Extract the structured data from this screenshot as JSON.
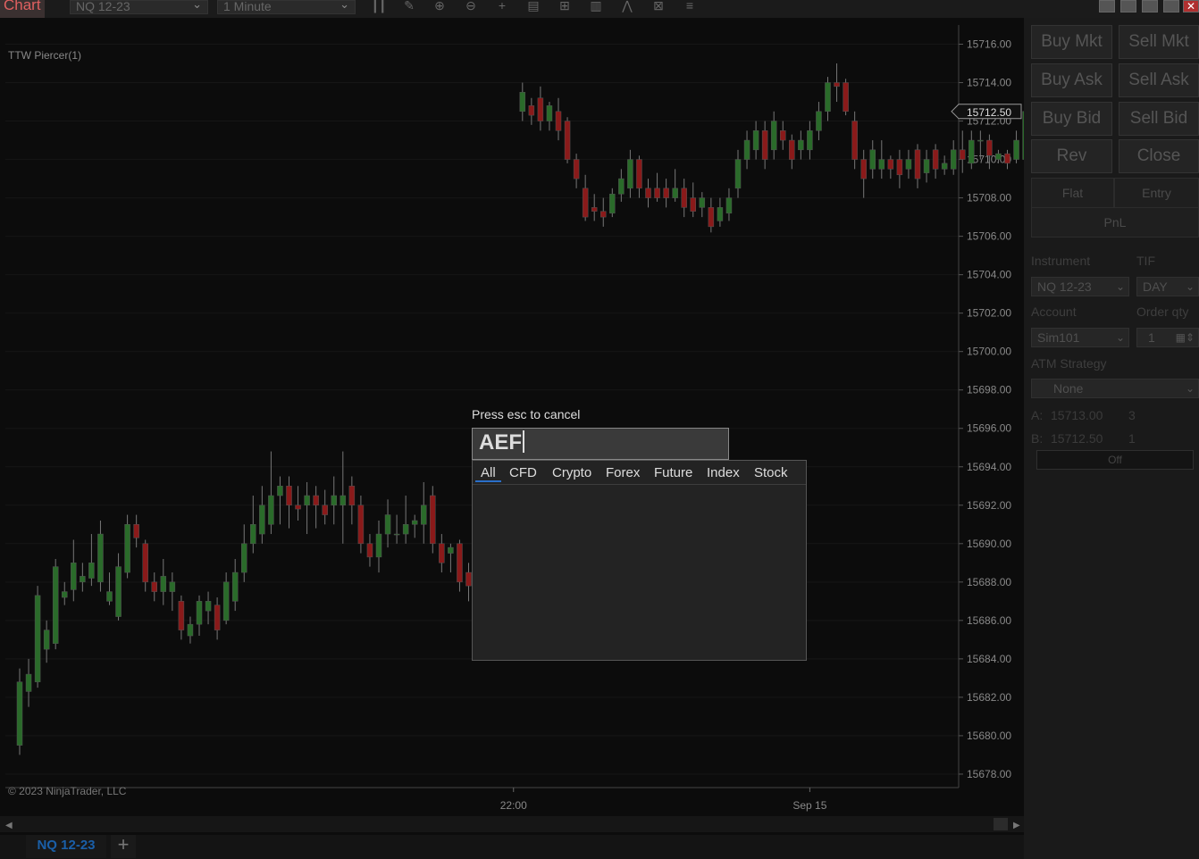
{
  "window": {
    "title": "Chart"
  },
  "toolbar": {
    "instrument": "NQ 12-23",
    "interval": "1 Minute",
    "icons": [
      "bars-type-icon",
      "pencil-draw-icon",
      "zoom-in-icon",
      "zoom-out-icon",
      "crosshair-icon",
      "data-box-icon",
      "strategy-icon",
      "indicators-icon",
      "drawing-tools-icon",
      "templates-icon",
      "properties-list-icon"
    ]
  },
  "chart": {
    "indicator_label": "TTW Piercer(1)",
    "copyright": "© 2023 NinjaTrader, LLC",
    "price_axis": [
      "15716.00",
      "15714.00",
      "15712.00",
      "15710.00",
      "15708.00",
      "15706.00",
      "15704.00",
      "15702.00",
      "15700.00",
      "15698.00",
      "15696.00",
      "15694.00",
      "15692.00",
      "15690.00",
      "15688.00",
      "15686.00",
      "15684.00",
      "15682.00",
      "15680.00",
      "15678.00"
    ],
    "last_price": "15712.50",
    "time_axis": [
      {
        "label": "22:00",
        "bar": 55
      },
      {
        "label": "Sep 15",
        "bar": 88
      }
    ],
    "up_color": "#2a6b2a",
    "down_color": "#8a1a1a",
    "candles": [
      [
        15679.5,
        15682.8,
        15679.0,
        15683.5
      ],
      [
        15682.3,
        15683.2,
        15681.5,
        15684.0
      ],
      [
        15682.8,
        15687.3,
        15682.5,
        15687.8
      ],
      [
        15684.5,
        15685.5,
        15683.8,
        15686.0
      ],
      [
        15684.8,
        15688.8,
        15684.5,
        15689.2
      ],
      [
        15687.2,
        15687.5,
        15686.8,
        15688.0
      ],
      [
        15687.6,
        15689.0,
        15687.0,
        15690.2
      ],
      [
        15688.0,
        15688.3,
        15687.5,
        15689.0
      ],
      [
        15688.2,
        15689.0,
        15687.8,
        15690.5
      ],
      [
        15688.0,
        15690.5,
        15687.5,
        15691.2
      ],
      [
        15687.0,
        15687.5,
        15686.8,
        15688.5
      ],
      [
        15686.2,
        15688.8,
        15686.0,
        15689.5
      ],
      [
        15688.5,
        15691.0,
        15688.2,
        15691.5
      ],
      [
        15691.0,
        15690.3,
        15689.8,
        15691.5
      ],
      [
        15690.0,
        15688.0,
        15687.5,
        15690.2
      ],
      [
        15688.0,
        15687.5,
        15687.0,
        15688.5
      ],
      [
        15687.5,
        15688.3,
        15686.8,
        15689.2
      ],
      [
        15687.5,
        15688.0,
        15686.5,
        15688.5
      ],
      [
        15687.0,
        15685.5,
        15685.0,
        15687.3
      ],
      [
        15685.2,
        15685.8,
        15684.8,
        15686.2
      ],
      [
        15685.8,
        15687.0,
        15685.2,
        15687.3
      ],
      [
        15686.5,
        15687.0,
        15685.8,
        15687.5
      ],
      [
        15686.8,
        15685.5,
        15685.0,
        15687.2
      ],
      [
        15686.0,
        15688.0,
        15685.8,
        15688.5
      ],
      [
        15687.0,
        15688.5,
        15686.5,
        15689.2
      ],
      [
        15688.5,
        15690.0,
        15688.0,
        15691.0
      ],
      [
        15690.0,
        15691.0,
        15689.5,
        15692.5
      ],
      [
        15690.5,
        15692.0,
        15690.0,
        15693.0
      ],
      [
        15691.0,
        15692.5,
        15690.5,
        15694.8
      ],
      [
        15692.5,
        15693.0,
        15691.0,
        15693.5
      ],
      [
        15693.0,
        15692.0,
        15690.8,
        15693.5
      ],
      [
        15692.0,
        15691.8,
        15691.2,
        15693.0
      ],
      [
        15692.0,
        15692.5,
        15690.5,
        15693.2
      ],
      [
        15692.5,
        15692.0,
        15690.8,
        15693.0
      ],
      [
        15692.0,
        15691.5,
        15691.0,
        15692.8
      ],
      [
        15692.0,
        15692.5,
        15691.0,
        15693.5
      ],
      [
        15692.0,
        15692.5,
        15690.0,
        15694.8
      ],
      [
        15693.0,
        15692.0,
        15691.0,
        15693.5
      ],
      [
        15692.0,
        15690.0,
        15689.5,
        15692.5
      ],
      [
        15690.0,
        15689.3,
        15688.8,
        15690.5
      ],
      [
        15689.3,
        15690.5,
        15688.5,
        15691.2
      ],
      [
        15690.5,
        15691.5,
        15689.8,
        15692.3
      ],
      [
        15690.5,
        15690.5,
        15690.0,
        15691.5
      ],
      [
        15690.5,
        15691.0,
        15690.0,
        15692.5
      ],
      [
        15691.0,
        15691.2,
        15690.3,
        15691.5
      ],
      [
        15691.0,
        15692.0,
        15690.0,
        15693.2
      ],
      [
        15692.5,
        15690.0,
        15689.5,
        15693.0
      ],
      [
        15690.0,
        15689.0,
        15688.5,
        15690.5
      ],
      [
        15689.5,
        15689.8,
        15688.5,
        15690.0
      ],
      [
        15690.0,
        15688.0,
        15687.5,
        15690.2
      ],
      [
        15688.5,
        15687.8,
        15687.0,
        15689.0
      ],
      [
        15688.0,
        15687.5,
        15686.8,
        15688.8
      ],
      [
        15687.8,
        15687.0,
        15686.8,
        15688.5
      ],
      [
        15687.5,
        15688.2,
        15687.0,
        15688.8
      ],
      [
        15688.0,
        15688.0,
        15687.5,
        15688.3
      ],
      [
        15688.2,
        15688.0,
        15687.8,
        15688.5
      ],
      [
        15712.5,
        15713.5,
        15712.0,
        15714.0
      ],
      [
        15712.8,
        15712.3,
        15711.8,
        15713.2
      ],
      [
        15713.2,
        15712.0,
        15711.5,
        15713.8
      ],
      [
        15712.0,
        15712.8,
        15711.5,
        15713.0
      ],
      [
        15712.5,
        15711.5,
        15711.0,
        15713.2
      ],
      [
        15712.0,
        15710.0,
        15709.8,
        15712.2
      ],
      [
        15710.0,
        15709.0,
        15708.5,
        15710.3
      ],
      [
        15708.5,
        15707.0,
        15706.8,
        15709.2
      ],
      [
        15707.5,
        15707.3,
        15706.8,
        15708.2
      ],
      [
        15707.3,
        15707.0,
        15706.5,
        15708.0
      ],
      [
        15707.2,
        15708.2,
        15707.0,
        15708.5
      ],
      [
        15708.2,
        15709.0,
        15707.8,
        15709.5
      ],
      [
        15708.5,
        15710.0,
        15708.0,
        15710.5
      ],
      [
        15710.0,
        15708.5,
        15708.0,
        15710.2
      ],
      [
        15708.5,
        15708.0,
        15707.5,
        15709.0
      ],
      [
        15708.5,
        15708.0,
        15707.8,
        15709.3
      ],
      [
        15708.5,
        15708.0,
        15707.5,
        15709.0
      ],
      [
        15708.0,
        15708.5,
        15707.8,
        15709.5
      ],
      [
        15708.5,
        15707.5,
        15707.0,
        15709.0
      ],
      [
        15708.0,
        15707.3,
        15707.0,
        15708.8
      ],
      [
        15707.5,
        15708.0,
        15707.0,
        15708.3
      ],
      [
        15707.5,
        15706.5,
        15706.2,
        15708.0
      ],
      [
        15706.8,
        15707.5,
        15706.5,
        15708.0
      ],
      [
        15707.2,
        15708.0,
        15706.8,
        15708.5
      ],
      [
        15708.5,
        15710.0,
        15708.0,
        15710.5
      ],
      [
        15710.0,
        15711.0,
        15709.5,
        15711.5
      ],
      [
        15710.5,
        15711.5,
        15710.0,
        15712.0
      ],
      [
        15711.5,
        15710.0,
        15709.5,
        15712.0
      ],
      [
        15710.5,
        15712.0,
        15710.0,
        15712.5
      ],
      [
        15711.5,
        15711.0,
        15710.5,
        15712.0
      ],
      [
        15711.0,
        15710.0,
        15709.5,
        15711.3
      ],
      [
        15710.5,
        15711.0,
        15710.0,
        15711.5
      ],
      [
        15710.5,
        15711.5,
        15710.0,
        15712.0
      ],
      [
        15711.5,
        15712.5,
        15711.0,
        15713.0
      ],
      [
        15712.5,
        15714.0,
        15712.0,
        15714.3
      ],
      [
        15714.0,
        15713.8,
        15713.0,
        15715.0
      ],
      [
        15714.0,
        15712.5,
        15712.3,
        15714.2
      ],
      [
        15712.0,
        15710.0,
        15709.5,
        15712.5
      ],
      [
        15710.0,
        15709.0,
        15708.0,
        15710.5
      ],
      [
        15709.5,
        15710.5,
        15709.0,
        15711.0
      ],
      [
        15709.5,
        15710.0,
        15709.0,
        15711.0
      ],
      [
        15710.0,
        15709.5,
        15709.0,
        15710.2
      ],
      [
        15710.0,
        15709.2,
        15708.5,
        15710.5
      ],
      [
        15709.5,
        15710.0,
        15709.0,
        15710.5
      ],
      [
        15710.5,
        15709.0,
        15708.5,
        15710.8
      ],
      [
        15709.3,
        15710.0,
        15708.8,
        15710.5
      ],
      [
        15710.5,
        15709.5,
        15709.0,
        15710.8
      ],
      [
        15709.5,
        15709.8,
        15709.2,
        15710.2
      ],
      [
        15709.5,
        15710.5,
        15709.2,
        15711.0
      ],
      [
        15710.5,
        15710.0,
        15709.3,
        15711.5
      ],
      [
        15709.8,
        15711.0,
        15709.5,
        15711.5
      ],
      [
        15711.0,
        15711.0,
        15710.0,
        15711.5
      ],
      [
        15711.0,
        15710.2,
        15709.5,
        15711.3
      ],
      [
        15710.0,
        15710.3,
        15709.8,
        15710.5
      ],
      [
        15710.3,
        15709.8,
        15709.5,
        15710.5
      ],
      [
        15710.0,
        15711.0,
        15709.8,
        15711.5
      ],
      [
        15710.0,
        15712.5,
        15709.8,
        15713.0
      ],
      [
        15712.0,
        15712.5,
        15711.8,
        15712.8
      ]
    ]
  },
  "tabs": {
    "active": "NQ 12-23",
    "add": "+"
  },
  "panel": {
    "buttons": {
      "buy_mkt": "Buy Mkt",
      "sell_mkt": "Sell Mkt",
      "buy_ask": "Buy Ask",
      "sell_ask": "Sell Ask",
      "buy_bid": "Buy Bid",
      "sell_bid": "Sell Bid",
      "rev": "Rev",
      "close": "Close"
    },
    "position": {
      "flat": "Flat",
      "entry": "Entry",
      "pnl": "PnL"
    },
    "instrument_label": "Instrument",
    "instrument_value": "NQ 12-23",
    "tif_label": "TIF",
    "tif_value": "DAY",
    "account_label": "Account",
    "account_value": "Sim101",
    "order_qty_label": "Order qty",
    "order_qty_value": "1",
    "atm_label": "ATM Strategy",
    "atm_value": "None",
    "ask_label": "A:",
    "ask_price": "15713.00",
    "ask_size": "3",
    "bid_label": "B:",
    "bid_price": "15712.50",
    "bid_size": "1",
    "off_label": "Off"
  },
  "overlay": {
    "hint": "Press esc to cancel",
    "search_value": "AEF",
    "filters": [
      "All",
      "CFD",
      "Crypto",
      "Forex",
      "Future",
      "Index",
      "Stock"
    ]
  }
}
